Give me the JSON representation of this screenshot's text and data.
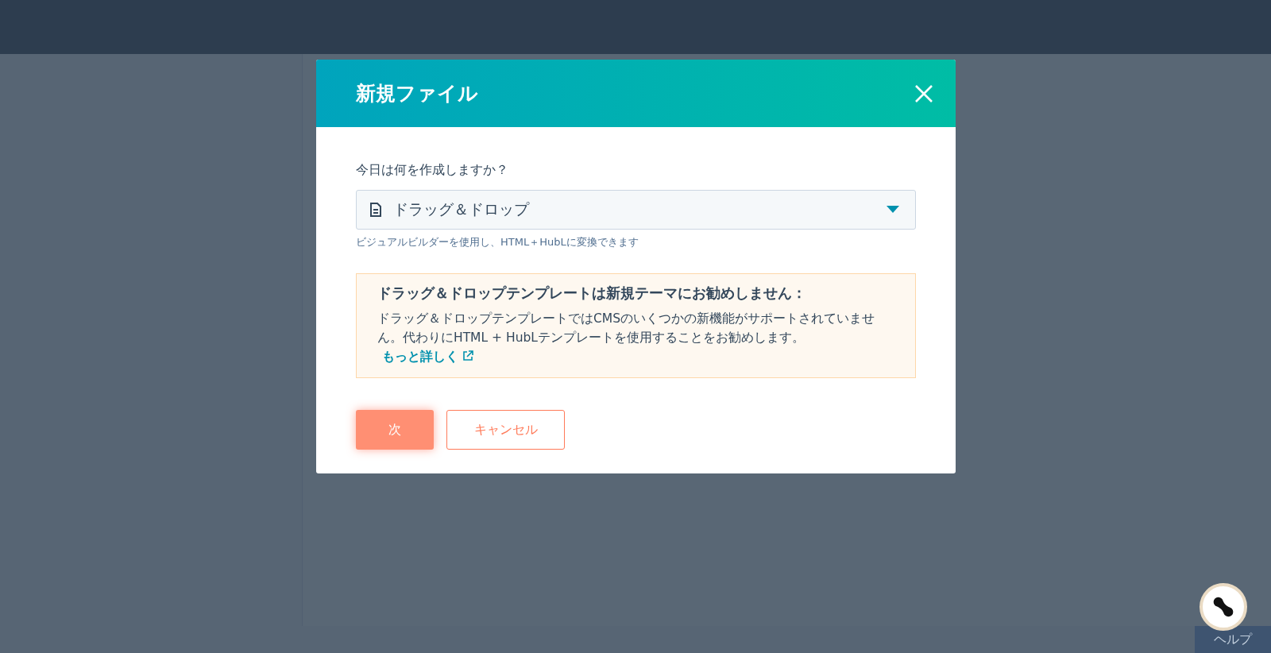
{
  "dialog": {
    "title": "新規ファイル",
    "question": "今日は何を作成しますか？",
    "select": {
      "value": "ドラッグ＆ドロップ"
    },
    "help_text": "ビジュアルビルダーを使用し、HTML＋HubLに変換できます",
    "warning": {
      "title": "ドラッグ＆ドロップテンプレートは新規テーマにお勧めしません：",
      "body": "ドラッグ＆ドロップテンプレートではCMSのいくつかの新機能がサポートされていません。代わりにHTML + HubLテンプレートを使用することをお勧めします。",
      "link": "もっと詳しく"
    },
    "buttons": [
      {
        "label": "次",
        "kind": "primary"
      },
      {
        "label": "キャンセル",
        "kind": "secondary"
      }
    ]
  },
  "help_tab": {
    "label": "ヘルプ"
  }
}
